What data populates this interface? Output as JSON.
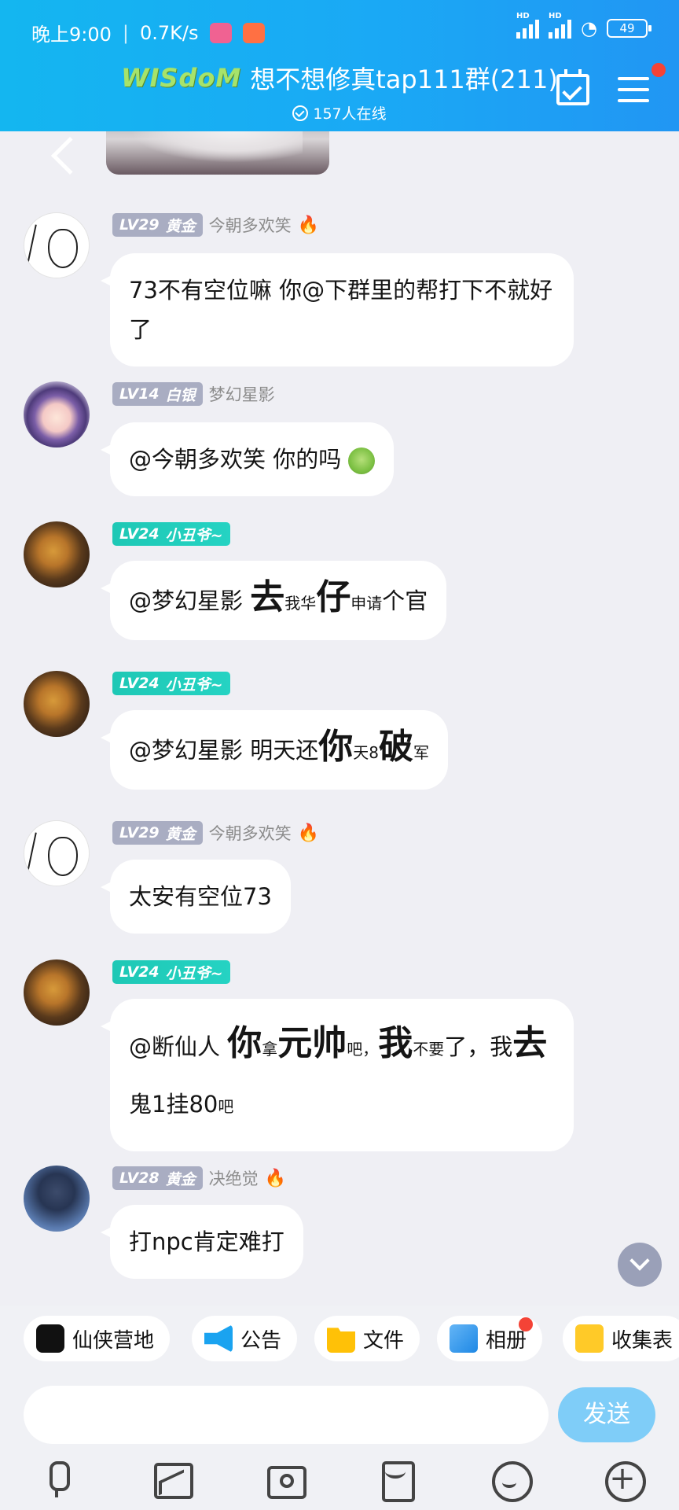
{
  "status_bar": {
    "time": "晚上9:00",
    "speed": "0.7K/s",
    "hd1": "HD",
    "hd2": "HD",
    "battery": "49"
  },
  "header": {
    "logo_text": "WISdoM",
    "group_name": "想不想修真tap111群(211)",
    "online": "157人在线",
    "icons": [
      "back-icon",
      "calendar-check-icon",
      "menu-icon"
    ]
  },
  "messages": [
    {
      "level": "LV29",
      "rank": "黄金",
      "nick": "今朝多欢笑",
      "fire": "🔥",
      "avatar": "sketch-avatar",
      "text": "73不有空位嘛 你@下群里的帮打下不就好了"
    },
    {
      "level": "LV14",
      "rank": "白银",
      "nick": "梦幻星影",
      "avatar": "anime-avatar",
      "text": "@今朝多欢笑 你的吗"
    },
    {
      "level": "LV24",
      "rank": "小丑爷~",
      "avatar": "cat-avatar",
      "parts": [
        "@梦幻星影 ",
        "去",
        "我华",
        "仔",
        "申请",
        "个官"
      ]
    },
    {
      "level": "LV24",
      "rank": "小丑爷~",
      "avatar": "cat-avatar",
      "parts": [
        "@梦幻星影 明天还",
        "你",
        "天8",
        "破",
        "军"
      ]
    },
    {
      "level": "LV29",
      "rank": "黄金",
      "nick": "今朝多欢笑",
      "fire": "🔥",
      "avatar": "sketch-avatar",
      "text": "太安有空位73"
    },
    {
      "level": "LV24",
      "rank": "小丑爷~",
      "avatar": "cat-avatar",
      "parts": [
        "@断仙人 ",
        "你",
        "拿",
        "元帅",
        "吧，",
        "我",
        "不要",
        "了，我",
        "去",
        "鬼1挂80",
        "吧"
      ]
    },
    {
      "level": "LV28",
      "rank": "黄金",
      "nick": "决绝觉",
      "fire": "🔥",
      "avatar": "boy-avatar",
      "text": "打npc肯定难打"
    }
  ],
  "shortcuts": [
    {
      "label": "仙侠营地",
      "icon": "camp-icon"
    },
    {
      "label": "公告",
      "icon": "megaphone-icon"
    },
    {
      "label": "文件",
      "icon": "folder-icon"
    },
    {
      "label": "相册",
      "icon": "album-icon"
    },
    {
      "label": "收集表",
      "icon": "collect-icon"
    }
  ],
  "composer": {
    "placeholder": "",
    "send_label": "发送"
  },
  "toolbar_icons": [
    "mic-icon",
    "photo-icon",
    "camera-icon",
    "red-packet-icon",
    "emoji-icon",
    "plus-icon"
  ]
}
